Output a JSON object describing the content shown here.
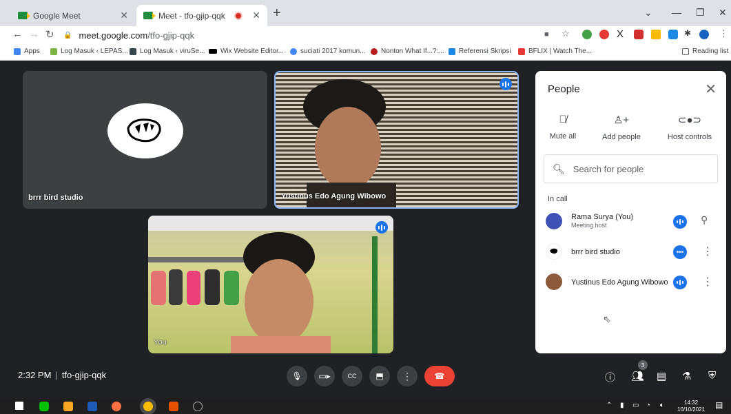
{
  "browser": {
    "tabs": [
      {
        "label": "Google Meet",
        "active": false
      },
      {
        "label": "Meet - tfo-gjip-qqk",
        "active": true
      }
    ],
    "url_host": "meet.google.com",
    "url_path": "/tfo-gjip-qqk",
    "bookmarks": [
      {
        "label": "Apps",
        "color": "#4285f4"
      },
      {
        "label": "Log Masuk ‹ LEPAS...",
        "color": "#7cb342"
      },
      {
        "label": "Log Masuk ‹ viruSe...",
        "color": "#37474f"
      },
      {
        "label": "Wix Website Editor...",
        "color": "#000000"
      },
      {
        "label": "suciati 2017 komun...",
        "color": "#4285f4"
      },
      {
        "label": "Nonton What If...?:...",
        "color": "#b71c1c"
      },
      {
        "label": "Referensi Skripsi",
        "color": "#1e88e5"
      },
      {
        "label": "BFLIX | Watch The...",
        "color": "#e53935"
      }
    ],
    "reading_list": "Reading list"
  },
  "stage": {
    "tile1_name": "brrr bird studio",
    "tile2_name": "Yustinus Edo Agung Wibowo",
    "tile3_name": "You"
  },
  "people_panel": {
    "title": "People",
    "actions": [
      {
        "label": "Mute all",
        "icon": "mic-off-icon"
      },
      {
        "label": "Add people",
        "icon": "add-person-icon"
      },
      {
        "label": "Host controls",
        "icon": "toggle-icon"
      }
    ],
    "search_placeholder": "Search for people",
    "section_label": "In call",
    "participants": [
      {
        "name": "Rama Surya (You)",
        "sub": "Meeting host",
        "status": "speaking",
        "extra": "pin-icon"
      },
      {
        "name": "brrr bird studio",
        "sub": "",
        "status": "more",
        "extra": "more-icon"
      },
      {
        "name": "Yustinus Edo Agung Wibowo",
        "sub": "",
        "status": "speaking",
        "extra": "more-icon"
      }
    ]
  },
  "bottom_bar": {
    "time": "2:32 PM",
    "meeting_code": "tfo-gjip-qqk",
    "participant_count": "3"
  },
  "taskbar": {
    "clock_time": "14:32",
    "clock_date": "10/10/2021"
  },
  "colors": {
    "accent": "#1a73e8",
    "hangup": "#ea4335",
    "stage_bg": "#202124"
  }
}
